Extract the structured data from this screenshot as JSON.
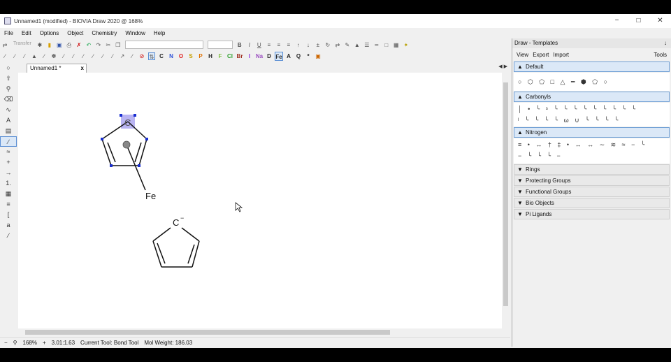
{
  "window": {
    "title": "Unnamed1 (modified) - BIOVIA Draw 2020 @ 168%",
    "minimize": "−",
    "maximize": "□",
    "close": "✕"
  },
  "menu": [
    "File",
    "Edit",
    "Options",
    "Object",
    "Chemistry",
    "Window",
    "Help"
  ],
  "toolbar1": {
    "transfer_label": "Transfer"
  },
  "elements": [
    {
      "sym": "C",
      "color": "#222222"
    },
    {
      "sym": "N",
      "color": "#2b4fd8"
    },
    {
      "sym": "O",
      "color": "#e02020"
    },
    {
      "sym": "S",
      "color": "#c8a000"
    },
    {
      "sym": "P",
      "color": "#e07000"
    },
    {
      "sym": "H",
      "color": "#222222"
    },
    {
      "sym": "F",
      "color": "#7fbf3f"
    },
    {
      "sym": "Cl",
      "color": "#2ea02e"
    },
    {
      "sym": "Br",
      "color": "#a03020"
    },
    {
      "sym": "I",
      "color": "#8a2be2"
    },
    {
      "sym": "Na",
      "color": "#9a4fc0"
    },
    {
      "sym": "D",
      "color": "#222222"
    },
    {
      "sym": "Fe",
      "color": "#222222"
    },
    {
      "sym": "A",
      "color": "#222222"
    },
    {
      "sym": "Q",
      "color": "#222222"
    },
    {
      "sym": "*",
      "color": "#222222"
    }
  ],
  "doc_tab": {
    "label": "Unnamed1 *",
    "close": "x"
  },
  "tab_nav": "◀ ▶",
  "canvas": {
    "atom_c_top": "C",
    "fe_label": "Fe",
    "anion_label": "C",
    "anion_charge": "−"
  },
  "status": {
    "zoom": "168%",
    "coords": "3.01:1.63",
    "current_tool": "Current Tool:  Bond Tool",
    "mol_weight": "Mol Weight:   186.03"
  },
  "panel": {
    "title": "Draw - Templates",
    "pin": "↓",
    "view": "View",
    "export": "Export",
    "import": "Import",
    "tools": "Tools",
    "sections": [
      {
        "label": "Default",
        "open": true,
        "content": "○ ⬡ ⬠ □ △ ━ ⬢ ⬠ ○"
      },
      {
        "label": "Carbonyls",
        "open": true,
        "content": "│ • ╰ ˢ ╰ ╰ ╰ ╰ ╰ ╰ ╰ ╰ ╰"
      },
      {
        "label": "Nitrogen",
        "open": true,
        "content": "≡ • ↔ † ‡ • ↔ ↔ ∼ ≋ ≈ − ╰"
      },
      {
        "label": "Rings",
        "open": false
      },
      {
        "label": "Protecting Groups",
        "open": false
      },
      {
        "label": "Functional Groups",
        "open": false
      },
      {
        "label": "Bio Objects",
        "open": false
      },
      {
        "label": "Pi Ligands",
        "open": false
      }
    ],
    "carbonyl_row2": "ˡ ╰ ╰ ╰ ╰ ω ∪ ╰ ╰ ╰ ╰",
    "nitrogen_row2": "− ╰ ╰ ╰ −"
  }
}
